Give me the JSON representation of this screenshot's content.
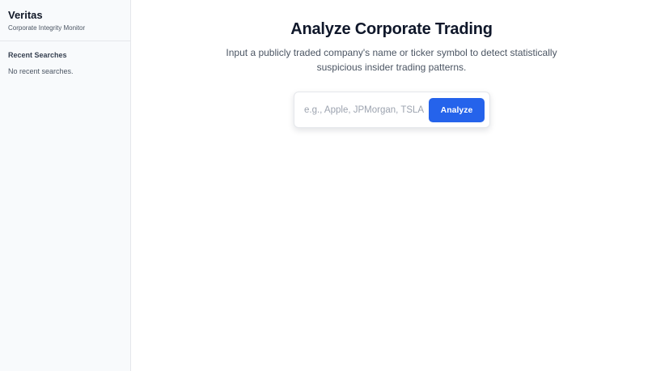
{
  "sidebar": {
    "brand_title": "Veritas",
    "brand_subtitle": "Corporate Integrity Monitor",
    "recent_heading": "Recent Searches",
    "recent_empty": "No recent searches."
  },
  "main": {
    "title": "Analyze Corporate Trading",
    "description": "Input a publicly traded company's name or ticker symbol to detect statistically suspicious insider trading patterns.",
    "search": {
      "placeholder": "e.g., Apple, JPMorgan, TSLA",
      "value": "",
      "button_label": "Analyze"
    }
  },
  "colors": {
    "accent": "#2563eb",
    "sidebar_bg": "#f8fafc",
    "text_primary": "#0f172a",
    "text_muted": "#4b5563"
  }
}
